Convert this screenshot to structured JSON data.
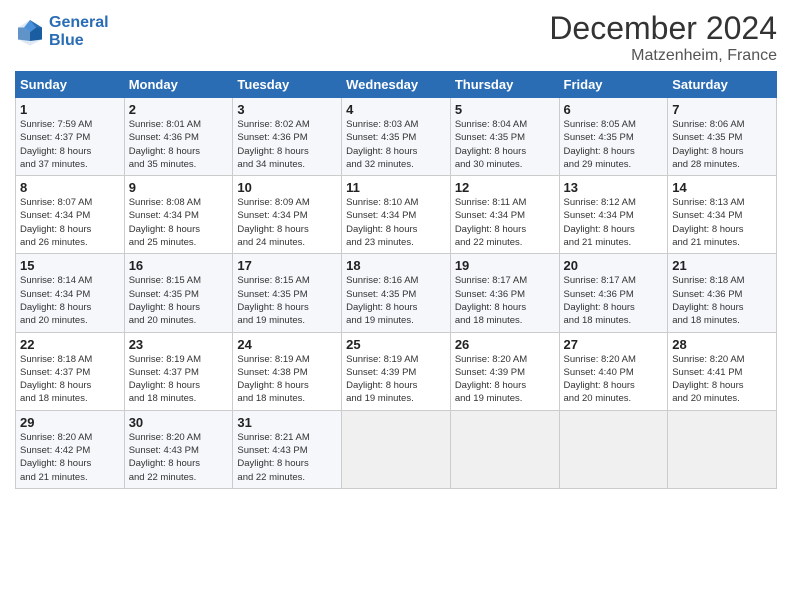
{
  "header": {
    "logo_line1": "General",
    "logo_line2": "Blue",
    "month": "December 2024",
    "location": "Matzenheim, France"
  },
  "days_of_week": [
    "Sunday",
    "Monday",
    "Tuesday",
    "Wednesday",
    "Thursday",
    "Friday",
    "Saturday"
  ],
  "weeks": [
    [
      {
        "day": "1",
        "info": "Sunrise: 7:59 AM\nSunset: 4:37 PM\nDaylight: 8 hours\nand 37 minutes."
      },
      {
        "day": "2",
        "info": "Sunrise: 8:01 AM\nSunset: 4:36 PM\nDaylight: 8 hours\nand 35 minutes."
      },
      {
        "day": "3",
        "info": "Sunrise: 8:02 AM\nSunset: 4:36 PM\nDaylight: 8 hours\nand 34 minutes."
      },
      {
        "day": "4",
        "info": "Sunrise: 8:03 AM\nSunset: 4:35 PM\nDaylight: 8 hours\nand 32 minutes."
      },
      {
        "day": "5",
        "info": "Sunrise: 8:04 AM\nSunset: 4:35 PM\nDaylight: 8 hours\nand 30 minutes."
      },
      {
        "day": "6",
        "info": "Sunrise: 8:05 AM\nSunset: 4:35 PM\nDaylight: 8 hours\nand 29 minutes."
      },
      {
        "day": "7",
        "info": "Sunrise: 8:06 AM\nSunset: 4:35 PM\nDaylight: 8 hours\nand 28 minutes."
      }
    ],
    [
      {
        "day": "8",
        "info": "Sunrise: 8:07 AM\nSunset: 4:34 PM\nDaylight: 8 hours\nand 26 minutes."
      },
      {
        "day": "9",
        "info": "Sunrise: 8:08 AM\nSunset: 4:34 PM\nDaylight: 8 hours\nand 25 minutes."
      },
      {
        "day": "10",
        "info": "Sunrise: 8:09 AM\nSunset: 4:34 PM\nDaylight: 8 hours\nand 24 minutes."
      },
      {
        "day": "11",
        "info": "Sunrise: 8:10 AM\nSunset: 4:34 PM\nDaylight: 8 hours\nand 23 minutes."
      },
      {
        "day": "12",
        "info": "Sunrise: 8:11 AM\nSunset: 4:34 PM\nDaylight: 8 hours\nand 22 minutes."
      },
      {
        "day": "13",
        "info": "Sunrise: 8:12 AM\nSunset: 4:34 PM\nDaylight: 8 hours\nand 21 minutes."
      },
      {
        "day": "14",
        "info": "Sunrise: 8:13 AM\nSunset: 4:34 PM\nDaylight: 8 hours\nand 21 minutes."
      }
    ],
    [
      {
        "day": "15",
        "info": "Sunrise: 8:14 AM\nSunset: 4:34 PM\nDaylight: 8 hours\nand 20 minutes."
      },
      {
        "day": "16",
        "info": "Sunrise: 8:15 AM\nSunset: 4:35 PM\nDaylight: 8 hours\nand 20 minutes."
      },
      {
        "day": "17",
        "info": "Sunrise: 8:15 AM\nSunset: 4:35 PM\nDaylight: 8 hours\nand 19 minutes."
      },
      {
        "day": "18",
        "info": "Sunrise: 8:16 AM\nSunset: 4:35 PM\nDaylight: 8 hours\nand 19 minutes."
      },
      {
        "day": "19",
        "info": "Sunrise: 8:17 AM\nSunset: 4:36 PM\nDaylight: 8 hours\nand 18 minutes."
      },
      {
        "day": "20",
        "info": "Sunrise: 8:17 AM\nSunset: 4:36 PM\nDaylight: 8 hours\nand 18 minutes."
      },
      {
        "day": "21",
        "info": "Sunrise: 8:18 AM\nSunset: 4:36 PM\nDaylight: 8 hours\nand 18 minutes."
      }
    ],
    [
      {
        "day": "22",
        "info": "Sunrise: 8:18 AM\nSunset: 4:37 PM\nDaylight: 8 hours\nand 18 minutes."
      },
      {
        "day": "23",
        "info": "Sunrise: 8:19 AM\nSunset: 4:37 PM\nDaylight: 8 hours\nand 18 minutes."
      },
      {
        "day": "24",
        "info": "Sunrise: 8:19 AM\nSunset: 4:38 PM\nDaylight: 8 hours\nand 18 minutes."
      },
      {
        "day": "25",
        "info": "Sunrise: 8:19 AM\nSunset: 4:39 PM\nDaylight: 8 hours\nand 19 minutes."
      },
      {
        "day": "26",
        "info": "Sunrise: 8:20 AM\nSunset: 4:39 PM\nDaylight: 8 hours\nand 19 minutes."
      },
      {
        "day": "27",
        "info": "Sunrise: 8:20 AM\nSunset: 4:40 PM\nDaylight: 8 hours\nand 20 minutes."
      },
      {
        "day": "28",
        "info": "Sunrise: 8:20 AM\nSunset: 4:41 PM\nDaylight: 8 hours\nand 20 minutes."
      }
    ],
    [
      {
        "day": "29",
        "info": "Sunrise: 8:20 AM\nSunset: 4:42 PM\nDaylight: 8 hours\nand 21 minutes."
      },
      {
        "day": "30",
        "info": "Sunrise: 8:20 AM\nSunset: 4:43 PM\nDaylight: 8 hours\nand 22 minutes."
      },
      {
        "day": "31",
        "info": "Sunrise: 8:21 AM\nSunset: 4:43 PM\nDaylight: 8 hours\nand 22 minutes."
      },
      {
        "day": "",
        "info": ""
      },
      {
        "day": "",
        "info": ""
      },
      {
        "day": "",
        "info": ""
      },
      {
        "day": "",
        "info": ""
      }
    ]
  ]
}
